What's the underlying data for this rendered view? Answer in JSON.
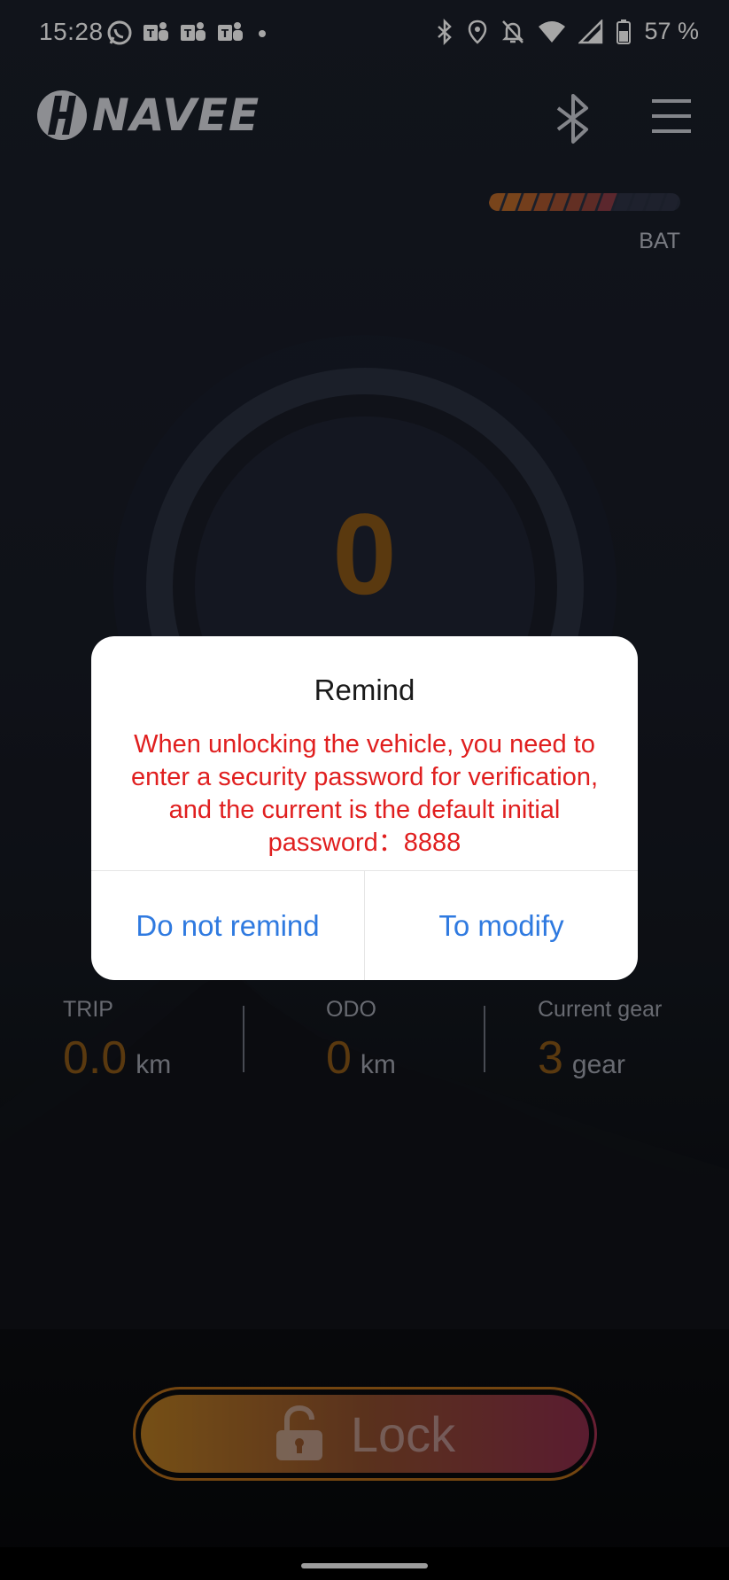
{
  "status_bar": {
    "time": "15:28",
    "battery_percent": "57 %",
    "left_icons": [
      "whatsapp-icon",
      "teams-icon",
      "teams-icon",
      "teams-icon",
      "dot-icon"
    ],
    "right_icons": [
      "bluetooth-icon",
      "location-icon",
      "bell-off-icon",
      "wifi-icon",
      "signal-icon",
      "battery-icon"
    ]
  },
  "header": {
    "logo_text": "NAVEE"
  },
  "battery": {
    "label": "BAT",
    "segments_total": 12,
    "segments_filled": 8,
    "colors": [
      "#b9692a",
      "#b9692a",
      "#b1602c",
      "#a9572e",
      "#a05032",
      "#984936",
      "#90433b",
      "#8c3d45"
    ]
  },
  "speed": {
    "value": "0"
  },
  "stats": {
    "trip": {
      "label": "TRIP",
      "value": "0.0",
      "unit": "km"
    },
    "odo": {
      "label": "ODO",
      "value": "0",
      "unit": "km"
    },
    "gear": {
      "label": "Current gear",
      "value": "3",
      "unit": "gear"
    }
  },
  "lock_button": {
    "label": "Lock"
  },
  "dialog": {
    "title": "Remind",
    "message": "When unlocking the vehicle, you need to enter a security password for verification, and the current is the default initial password：8888",
    "cancel_label": "Do not remind",
    "confirm_label": "To modify"
  },
  "colors": {
    "accent_orange": "#8a5818",
    "dialog_message": "#e01f1f",
    "dialog_button": "#2f7ae0"
  }
}
